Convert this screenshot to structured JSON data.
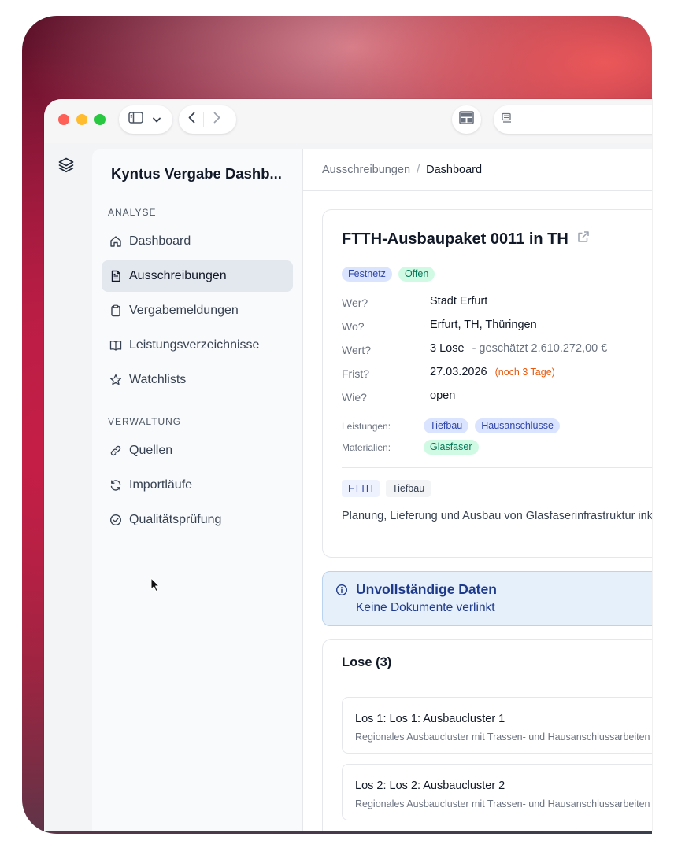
{
  "app": {
    "title": "Kyntus Vergabe Dashb..."
  },
  "sidebar": {
    "sections": [
      {
        "label": "ANALYSE",
        "items": [
          {
            "label": "Dashboard",
            "icon": "home-icon"
          },
          {
            "label": "Ausschreibungen",
            "icon": "document-icon",
            "active": true
          },
          {
            "label": "Vergabemeldungen",
            "icon": "clipboard-icon"
          },
          {
            "label": "Leistungsverzeichnisse",
            "icon": "book-icon"
          },
          {
            "label": "Watchlists",
            "icon": "star-icon"
          }
        ]
      },
      {
        "label": "VERWALTUNG",
        "items": [
          {
            "label": "Quellen",
            "icon": "link-icon"
          },
          {
            "label": "Importläufe",
            "icon": "refresh-icon"
          },
          {
            "label": "Qualitätsprüfung",
            "icon": "check-circle-icon"
          }
        ]
      }
    ]
  },
  "breadcrumb": {
    "parent": "Ausschreibungen",
    "separator": "/",
    "current": "Dashboard"
  },
  "tender": {
    "title": "FTTH-Ausbaupaket 0011 in TH",
    "badges": [
      "Festnetz",
      "Offen"
    ],
    "fields": [
      {
        "label": "Wer?",
        "value": "Stadt Erfurt"
      },
      {
        "label": "Wo?",
        "value": "Erfurt, TH, Thüringen"
      },
      {
        "label": "Wert?",
        "value": "3 Lose",
        "extra": "- geschätzt 2.610.272,00 €"
      },
      {
        "label": "Frist?",
        "value": "27.03.2026",
        "extra": "(noch 3 Tage)"
      },
      {
        "label": "Wie?",
        "value": "open"
      }
    ],
    "leistungen_label": "Leistungen:",
    "leistungen": [
      "Tiefbau",
      "Hausanschlüsse"
    ],
    "materialien_label": "Materialien:",
    "materialien": [
      "Glasfaser"
    ],
    "tags": [
      "FTTH",
      "Tiefbau"
    ],
    "description": "Planung, Lieferung und Ausbau von Glasfaserinfrastruktur ink"
  },
  "alert": {
    "title": "Unvollständige Daten",
    "text": "Keine Dokumente verlinkt"
  },
  "lose": {
    "title": "Lose (3)",
    "items": [
      {
        "title": "Los 1: Los 1: Ausbaucluster 1",
        "description": "Regionales Ausbaucluster mit Trassen- und Hausanschlussarbeiten"
      },
      {
        "title": "Los 2: Los 2: Ausbaucluster 2",
        "description": "Regionales Ausbaucluster mit Trassen- und Hausanschlussarbeiten"
      }
    ]
  },
  "colors": {
    "accent_blue": "#2f45a8",
    "status_green": "#047857",
    "warning_orange": "#ea580c",
    "alert_bg": "#e6f0fb"
  }
}
